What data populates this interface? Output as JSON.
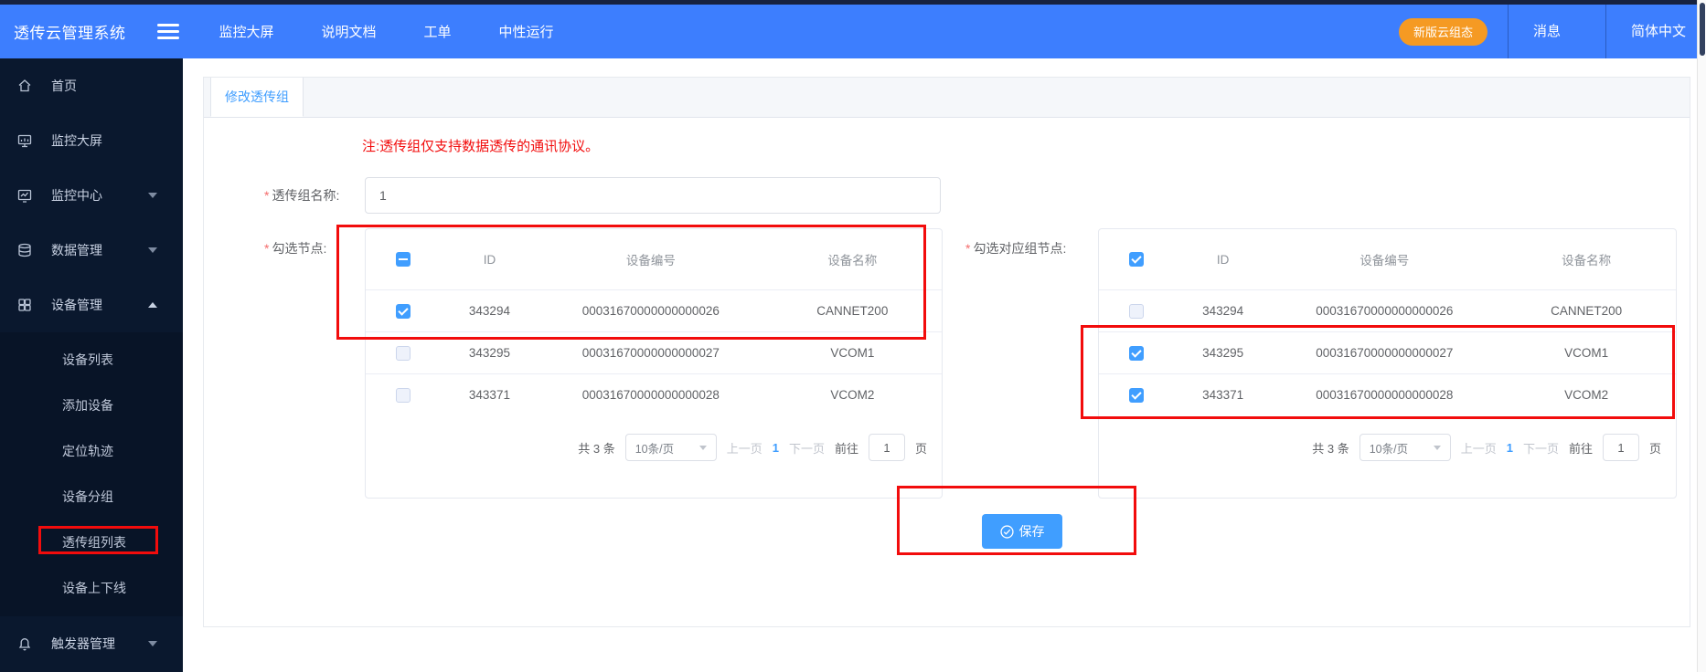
{
  "header": {
    "title": "透传云管理系统",
    "nav": [
      "监控大屏",
      "说明文档",
      "工单",
      "中性运行"
    ],
    "cta_label": "新版云组态",
    "messages_label": "消息",
    "lang_label": "简体中文"
  },
  "sidebar": {
    "items": [
      {
        "label": "首页",
        "icon": "home-icon"
      },
      {
        "label": "监控大屏",
        "icon": "monitor-icon"
      },
      {
        "label": "监控中心",
        "icon": "monitor-chart-icon"
      },
      {
        "label": "数据管理",
        "icon": "database-icon"
      },
      {
        "label": "设备管理",
        "icon": "grid-icon"
      }
    ],
    "submenu": [
      "设备列表",
      "添加设备",
      "定位轨迹",
      "设备分组",
      "透传组列表",
      "设备上下线"
    ],
    "bottom_item": {
      "label": "触发器管理",
      "icon": "bell-icon"
    }
  },
  "tabs": [
    {
      "label": "修改透传组"
    }
  ],
  "note": "注:透传组仅支持数据透传的通讯协议。",
  "form": {
    "required_mark": "*",
    "name_label": "透传组名称:",
    "name_value": "1",
    "nodes_label": "勾选节点:",
    "group_nodes_label": "勾选对应组节点:"
  },
  "table": {
    "columns": [
      "ID",
      "设备编号",
      "设备名称"
    ],
    "left": {
      "header_state": "indeterminate",
      "rows": [
        {
          "id": "343294",
          "code": "00031670000000000026",
          "name": "CANNET200",
          "state": "checked"
        },
        {
          "id": "343295",
          "code": "00031670000000000027",
          "name": "VCOM1",
          "state": "unchecked"
        },
        {
          "id": "343371",
          "code": "00031670000000000028",
          "name": "VCOM2",
          "state": "unchecked"
        }
      ]
    },
    "right": {
      "header_state": "checked",
      "rows": [
        {
          "id": "343294",
          "code": "00031670000000000026",
          "name": "CANNET200",
          "state": "unchecked"
        },
        {
          "id": "343295",
          "code": "00031670000000000027",
          "name": "VCOM1",
          "state": "checked"
        },
        {
          "id": "343371",
          "code": "00031670000000000028",
          "name": "VCOM2",
          "state": "checked"
        }
      ]
    }
  },
  "pagination": {
    "total": "共 3 条",
    "page_size": "10条/页",
    "prev": "上一页",
    "current_page": "1",
    "next": "下一页",
    "goto_label": "前往",
    "goto_value": "1",
    "unit_label": "页"
  },
  "save": {
    "label": "保存"
  },
  "colors": {
    "header_blue": "#3d7efe",
    "accent_blue": "#409eff",
    "cta_orange": "#f59a23",
    "annotation_red": "#f20c0c",
    "note_red": "#f20c0c",
    "sidebar_bg": "#0a182e",
    "sidebar_submenu_bg": "#081427"
  }
}
